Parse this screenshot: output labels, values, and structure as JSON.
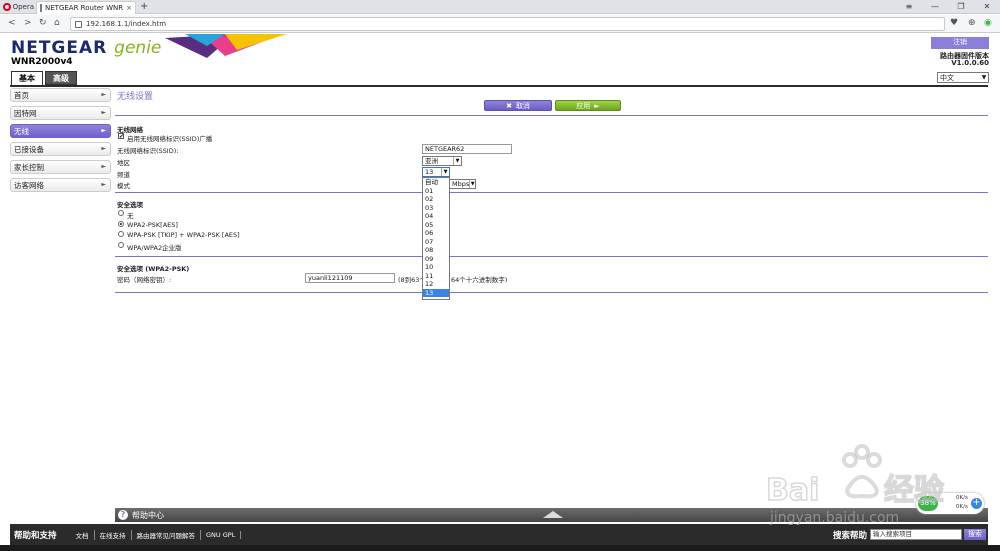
{
  "browser": {
    "app_name": "Opera",
    "tab_title": "NETGEAR Router WNR",
    "tab_close": "×",
    "newtab": "+",
    "url": "192.168.1.1/index.htm",
    "win_controls": [
      "≡",
      "—",
      "❐",
      "✕"
    ]
  },
  "header": {
    "logo_brand": "NETGEAR",
    "logo_genie": "genie",
    "model": "WNR2000v4",
    "tabs": [
      {
        "label": "基本",
        "active": true
      },
      {
        "label": "高级",
        "active": false
      }
    ],
    "logout_label": "注销",
    "fw_label": "路由器固件版本",
    "fw_version": "V1.0.0.60",
    "language": "中文"
  },
  "sidebar": {
    "items": [
      {
        "label": "首页",
        "active": false
      },
      {
        "label": "因特网",
        "active": false
      },
      {
        "label": "无线",
        "active": true
      },
      {
        "label": "已接设备",
        "active": false
      },
      {
        "label": "家长控制",
        "active": false
      },
      {
        "label": "访客网络",
        "active": false
      }
    ]
  },
  "main": {
    "title": "无线设置",
    "cancel_label": "取消",
    "apply_label": "应用",
    "wireless_network_title": "无线网络",
    "ssid_broadcast_label": "启用无线网络标识(SSID)广播",
    "ssid_label": "无线网络标识(SSID):",
    "ssid_value": "NETGEAR62",
    "region_label": "地区",
    "region_value": "亚洲",
    "channel_label": "频道",
    "channel_value": "13",
    "mode_label": "模式",
    "mode_value_partial": "Mbps",
    "channel_options": [
      "自动",
      "01",
      "02",
      "03",
      "04",
      "05",
      "06",
      "07",
      "08",
      "09",
      "10",
      "11",
      "12",
      "13"
    ],
    "security_title": "安全选项",
    "security_options": [
      {
        "label": "无",
        "selected": false
      },
      {
        "label": "WPA2-PSK[AES]",
        "selected": true
      },
      {
        "label": "WPA-PSK [TKIP] + WPA2-PSK [AES]",
        "selected": false
      },
      {
        "label": "WPA/WPA2企业版",
        "selected": false
      }
    ],
    "wpa_title": "安全选项 (WPA2-PSK)",
    "password_label": "密码（网络密钥）:",
    "password_value": "yuanli121109",
    "password_hint_left": "(8到63个",
    "password_hint_right": "64个十六进制数字)"
  },
  "help": {
    "label": "帮助中心"
  },
  "footer": {
    "title": "帮助和支持",
    "links": [
      "文档",
      "在线支持",
      "路由器常见问题解答",
      "GNU GPL"
    ],
    "search_label": "搜索帮助",
    "search_placeholder": "输入搜索项目",
    "search_button": "搜索"
  },
  "speed_widget": {
    "percent": "38%",
    "up": "0K/s",
    "down": "0K/s"
  },
  "watermark": {
    "text": "jingyan.baidu.com"
  }
}
